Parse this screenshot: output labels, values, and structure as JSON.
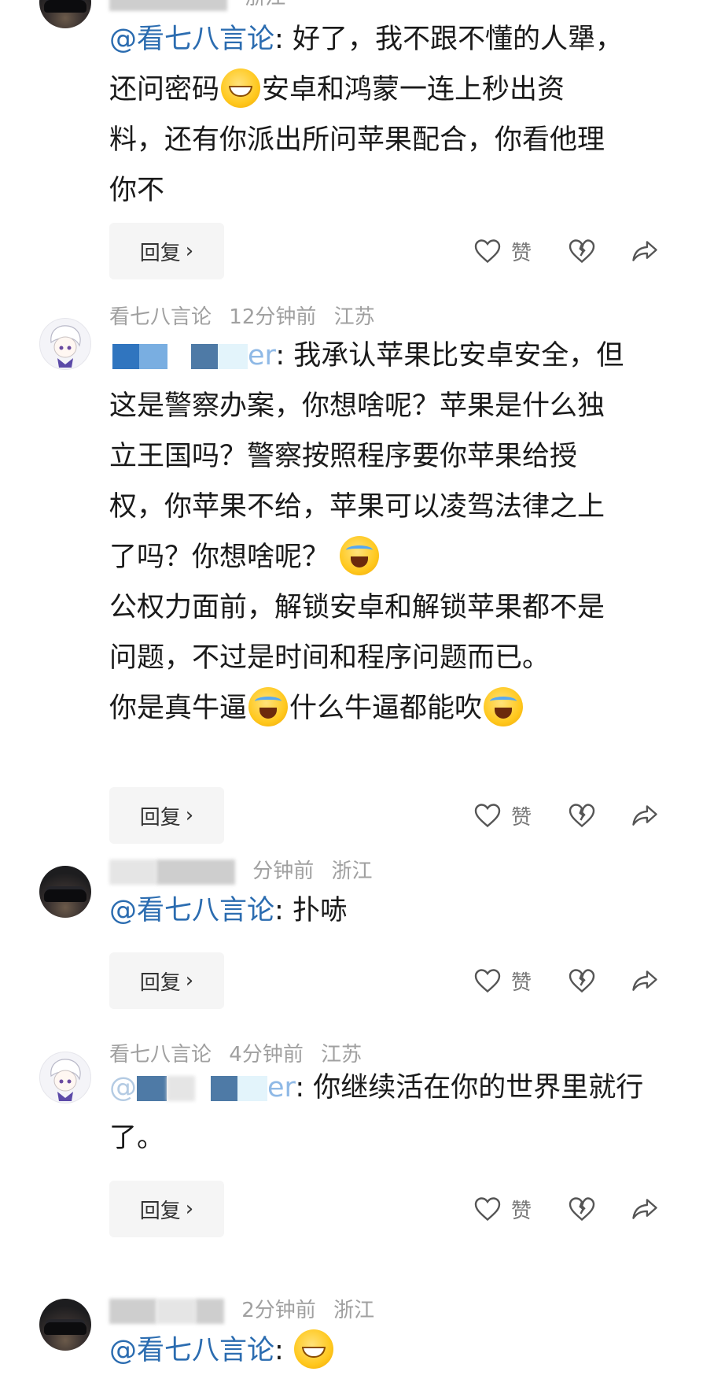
{
  "comments": [
    {
      "id": "c1",
      "location": "浙江",
      "mention": "@看七八言论",
      "lines": [
        "好了，我不跟不懂的人犟，",
        "还问密码",
        "安卓和鸿蒙一连上秒出资",
        "料，还有你派出所问苹果配合，你看他理",
        "你不"
      ],
      "reply_label": "回复",
      "like_label": "赞"
    },
    {
      "id": "c2",
      "username": "看七八言论",
      "time": "12分钟前",
      "location": "江苏",
      "mention_suffix": "er",
      "lines": [
        "我承认苹果比安卓安全，但",
        "这是警察办案，你想啥呢？苹果是什么独",
        "立王国吗？警察按照程序要你苹果给授",
        "权，你苹果不给，苹果可以凌驾法律之上",
        "了吗？你想啥呢？",
        "公权力面前，解锁安卓和解锁苹果都不是",
        "问题，不过是时间和程序问题而已。",
        "你是真牛逼",
        "什么牛逼都能吹"
      ],
      "reply_label": "回复",
      "like_label": "赞"
    },
    {
      "id": "c3",
      "time_suffix": "分钟前",
      "location": "浙江",
      "mention": "@看七八言论",
      "text": "扑哧",
      "reply_label": "回复",
      "like_label": "赞"
    },
    {
      "id": "c4",
      "username": "看七八言论",
      "time": "4分钟前",
      "location": "江苏",
      "mention_prefix": "@",
      "mention_suffix": "er",
      "lines": [
        "你继续活在你的世界里就行",
        "了。"
      ],
      "reply_label": "回复",
      "like_label": "赞"
    },
    {
      "id": "c5",
      "time": "2分钟前",
      "location": "浙江",
      "mention": "@看七八言论"
    }
  ]
}
